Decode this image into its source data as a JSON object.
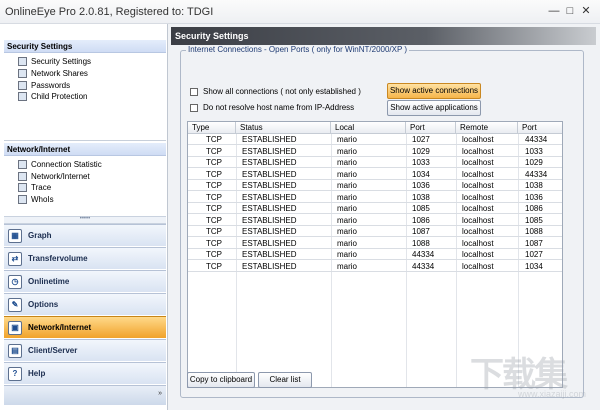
{
  "window": {
    "title": "OnlineEye Pro 2.0.81, Registered to: TDGI",
    "min_glyph": "—",
    "max_glyph": "□",
    "close_glyph": "✕"
  },
  "sidebar": {
    "sections": [
      {
        "title": "Security Settings",
        "items": [
          {
            "label": "Security Settings",
            "icon": "shield-icon"
          },
          {
            "label": "Network Shares",
            "icon": "share-icon"
          },
          {
            "label": "Passwords",
            "icon": "key-icon"
          },
          {
            "label": "Child Protection",
            "icon": "child-icon"
          }
        ]
      },
      {
        "title": "Network/Internet",
        "items": [
          {
            "label": "Connection Statistic",
            "icon": "stats-icon"
          },
          {
            "label": "Network/Internet",
            "icon": "network-icon"
          },
          {
            "label": "Trace",
            "icon": "trace-icon"
          },
          {
            "label": "WhoIs",
            "icon": "whois-icon"
          }
        ]
      }
    ],
    "nav": [
      {
        "label": "Graph",
        "icon": "graph-icon",
        "active": false
      },
      {
        "label": "Transfervolume",
        "icon": "transfer-icon",
        "active": false
      },
      {
        "label": "Onlinetime",
        "icon": "clock-icon",
        "active": false
      },
      {
        "label": "Options",
        "icon": "options-icon",
        "active": false
      },
      {
        "label": "Network/Internet",
        "icon": "network-icon",
        "active": true
      },
      {
        "label": "Client/Server",
        "icon": "server-icon",
        "active": false
      },
      {
        "label": "Help",
        "icon": "help-icon",
        "active": false
      }
    ],
    "grip_text": "•••••",
    "bottom_arrows": "»"
  },
  "main": {
    "header": "Security Settings",
    "group_title": "Internet Connections - Open Ports ( only for WinNT/2000/XP )",
    "checkbox_all": "Show all connections ( not only established )",
    "checkbox_resolve": "Do not resolve host name from IP-Address",
    "btn_active_connections": "Show active connections",
    "btn_active_applications": "Show active applications",
    "btn_copy": "Copy to clipboard",
    "btn_clear": "Clear list",
    "columns": [
      "Type",
      "Status",
      "Local",
      "Port",
      "Remote",
      "Port"
    ],
    "rows": [
      [
        "TCP",
        "ESTABLISHED",
        "mario",
        "1027",
        "localhost",
        "44334"
      ],
      [
        "TCP",
        "ESTABLISHED",
        "mario",
        "1029",
        "localhost",
        "1033"
      ],
      [
        "TCP",
        "ESTABLISHED",
        "mario",
        "1033",
        "localhost",
        "1029"
      ],
      [
        "TCP",
        "ESTABLISHED",
        "mario",
        "1034",
        "localhost",
        "44334"
      ],
      [
        "TCP",
        "ESTABLISHED",
        "mario",
        "1036",
        "localhost",
        "1038"
      ],
      [
        "TCP",
        "ESTABLISHED",
        "mario",
        "1038",
        "localhost",
        "1036"
      ],
      [
        "TCP",
        "ESTABLISHED",
        "mario",
        "1085",
        "localhost",
        "1086"
      ],
      [
        "TCP",
        "ESTABLISHED",
        "mario",
        "1086",
        "localhost",
        "1085"
      ],
      [
        "TCP",
        "ESTABLISHED",
        "mario",
        "1087",
        "localhost",
        "1088"
      ],
      [
        "TCP",
        "ESTABLISHED",
        "mario",
        "1088",
        "localhost",
        "1087"
      ],
      [
        "TCP",
        "ESTABLISHED",
        "mario",
        "44334",
        "localhost",
        "1027"
      ],
      [
        "TCP",
        "ESTABLISHED",
        "mario",
        "44334",
        "localhost",
        "1034"
      ]
    ]
  },
  "watermark": {
    "text": "下载集",
    "url": "www.xiazaiji.com"
  },
  "colors": {
    "active_nav": "#f1a22b",
    "header_dark": "#3b3e45",
    "link_blue": "#1f3b73"
  }
}
